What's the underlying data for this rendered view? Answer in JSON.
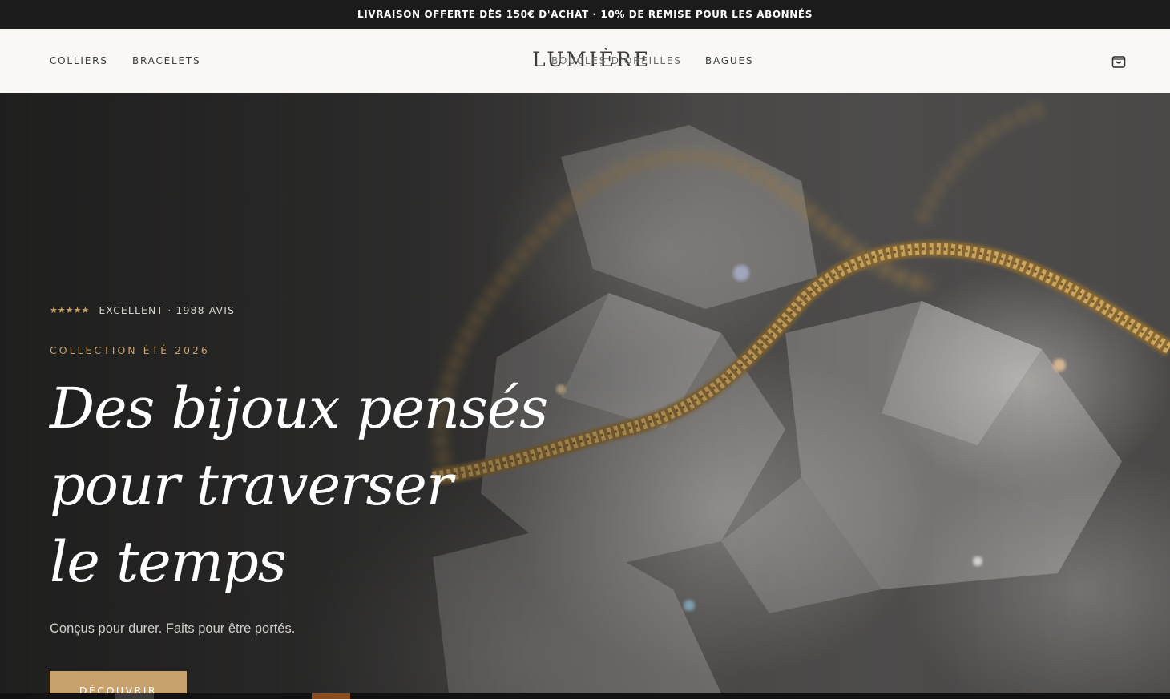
{
  "announcement": {
    "text": "LIVRAISON OFFERTE DÈS 150€ D'ACHAT · 10% DE REMISE POUR LES ABONNÉS"
  },
  "header": {
    "logo": "LUMIÈRE",
    "nav": {
      "colliers": "COLLIERS",
      "bracelets": "BRACELETS",
      "boucles": "BOUCLES D'OREILLES",
      "bagues": "BAGUES"
    },
    "cart_icon": "shopping-bag-icon"
  },
  "hero": {
    "stars": "★★★★★",
    "rating_text": "EXCELLENT · 1988 AVIS",
    "eyebrow": "COLLECTION ÉTÉ 2026",
    "headline": {
      "line1": "Des bijoux pensés",
      "line2": "pour traverser",
      "line3": "le temps"
    },
    "subtitle": "Conçus pour durer. Faits pour être portés.",
    "cta_label": "DÉCOUVRIR"
  },
  "colors": {
    "accent_gold": "#c8a06b",
    "announce_bg": "#1b1b1b",
    "header_bg": "#f9f8f4"
  }
}
